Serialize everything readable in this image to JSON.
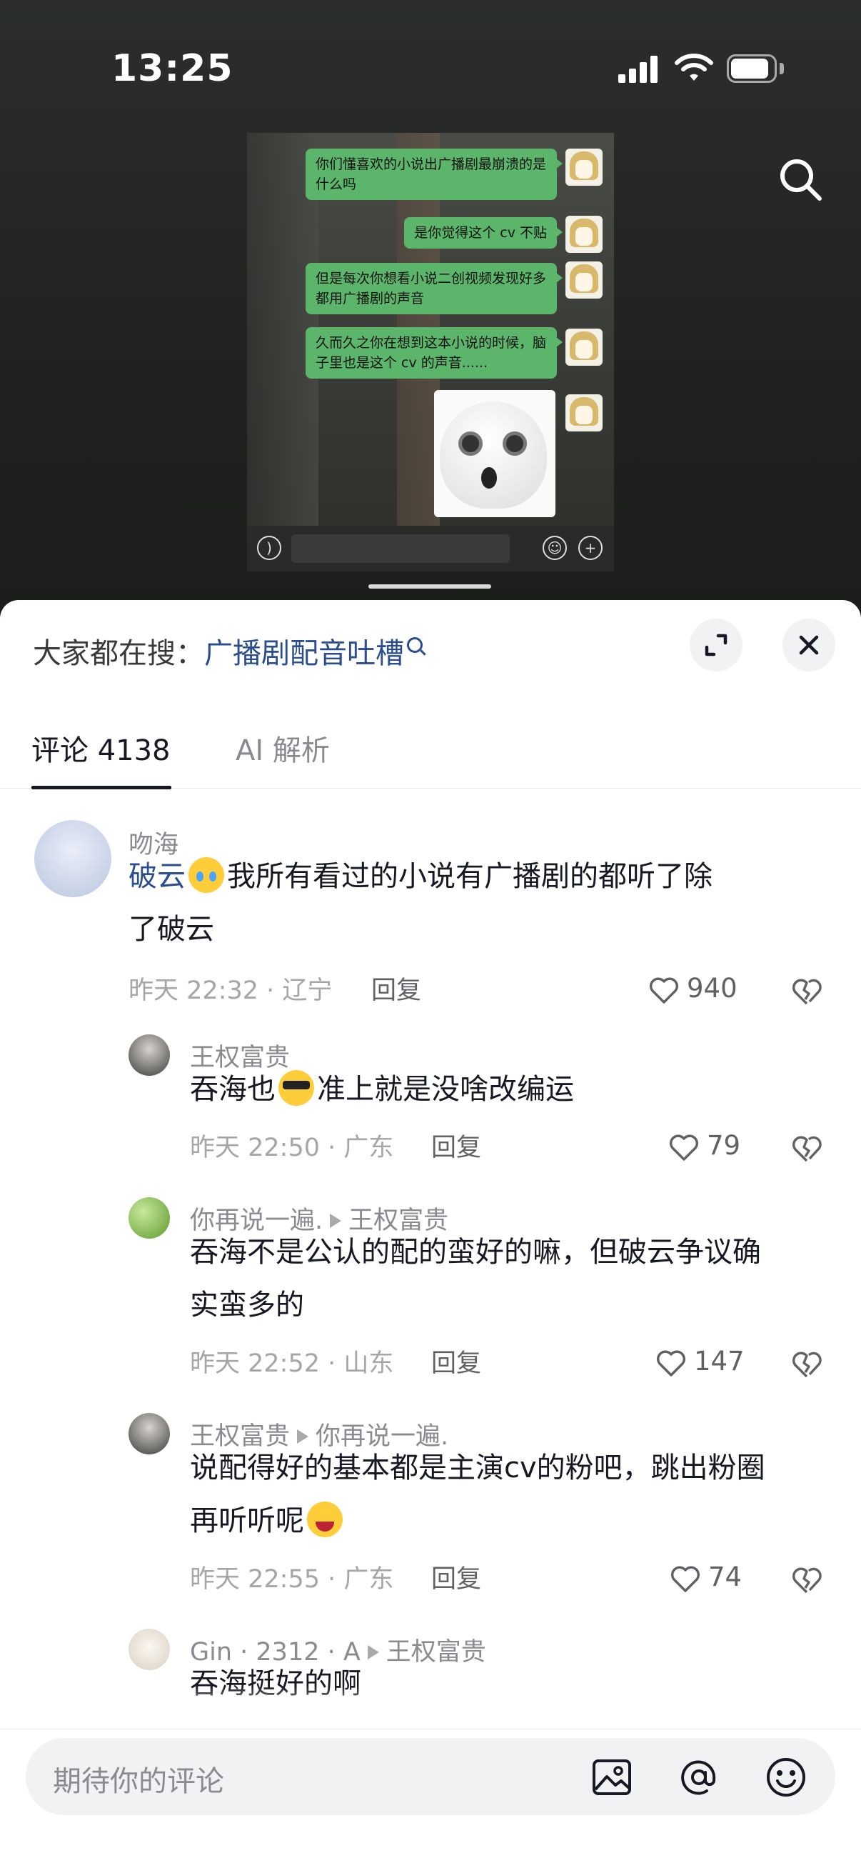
{
  "status_bar": {
    "time": "13:25"
  },
  "chat_screenshot": {
    "messages": [
      "你们懂喜欢的小说出广播剧最崩溃的是什么吗",
      "是你觉得这个 cv 不贴",
      "但是每次你想看小说二创视频发现好多都用广播剧的声音",
      "久而久之你在想到这本小说的时候，脑子里也是这个 cv 的声音......"
    ]
  },
  "sheet": {
    "hot_search_prefix": "大家都在搜：",
    "hot_search_keyword": "广播剧配音吐槽",
    "tabs": [
      {
        "label": "评论 4138",
        "active": true
      },
      {
        "label": "AI 解析",
        "active": false
      }
    ]
  },
  "comments": [
    {
      "user": "吻海",
      "text_keyword": "破云",
      "text_line1": "我所有看过的小说有广播剧的都听了除",
      "text_line2": "了破云",
      "meta": "昨天 22:32 · 辽宁",
      "reply": "回复",
      "likes": "940"
    },
    {
      "user": "王权富贵",
      "text_a": "吞海也",
      "text_b": "准上就是没啥改编运",
      "meta": "昨天 22:50 · 广东",
      "reply": "回复",
      "likes": "79"
    },
    {
      "user": "你再说一遍.",
      "reply_to": "王权富贵",
      "text_line1": "吞海不是公认的配的蛮好的嘛，但破云争议确",
      "text_line2": "实蛮多的",
      "meta": "昨天 22:52 · 山东",
      "reply": "回复",
      "likes": "147"
    },
    {
      "user": "王权富贵",
      "reply_to": "你再说一遍.",
      "text_line1": "说配得好的基本都是主演cv的粉吧，跳出粉圈",
      "text_line2": "再听听呢",
      "meta": "昨天 22:55 · 广东",
      "reply": "回复",
      "likes": "74"
    },
    {
      "user": "Gin · 2312 · A",
      "reply_to": "王权富贵",
      "text_line1": "吞海挺好的啊"
    }
  ],
  "input": {
    "placeholder": "期待你的评论"
  },
  "icons": [
    "search-icon",
    "expand-icon",
    "close-icon",
    "heart-icon",
    "broken-heart-icon",
    "image-icon",
    "at-icon",
    "emoji-icon"
  ]
}
